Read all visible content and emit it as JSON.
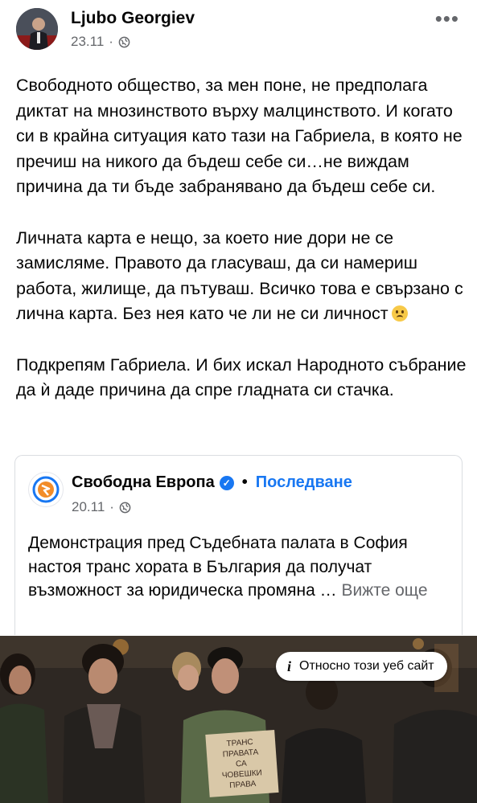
{
  "post": {
    "author": "Ljubo Georgiev",
    "date": "23.11",
    "dot": "·",
    "more_icon": "more-dots-icon",
    "paragraphs": [
      "Свободното общество, за мен поне, не предполага диктат на мнозинството върху малцинството. И когато си в крайна ситуация като тази на Габриела, в която не пречиш на никого да бъдеш себе си…не виждам причина да ти бъде забранявано да бъдеш себе си.",
      "Личната карта е нещо, за което ние дори не се замисляме. Правото да гласуваш, да си намериш работа, жилище, да пътуваш. Всичко това е свързано с лична карта. Без нея като че ли не си личност",
      "Подкрепям Габриела. И бих искал Народното събрание да ѝ даде причина да спре гладната си стачка."
    ]
  },
  "shared": {
    "page_name": "Свободна Европа",
    "separator": "•",
    "follow_label": "Последване",
    "date": "20.11",
    "dot": "·",
    "text": "Демонстрация пред Съдебната палата в София настоя транс хората в България да получат възможност за юридическа промяна …",
    "see_more": "Вижте още"
  },
  "photo": {
    "sign_line1": "ТРАНС",
    "sign_line2": "ПРАВАТА",
    "sign_line3": "СА",
    "sign_line4": "ЧОВЕШКИ",
    "sign_line5": "ПРАВА"
  },
  "site_pill": {
    "label": "Относно този уеб сайт",
    "icon": "info-icon"
  },
  "colors": {
    "link": "#1877f2",
    "secondary_text": "#65676b",
    "verified": "#1877f2",
    "rfe_orange": "#f28c28"
  }
}
